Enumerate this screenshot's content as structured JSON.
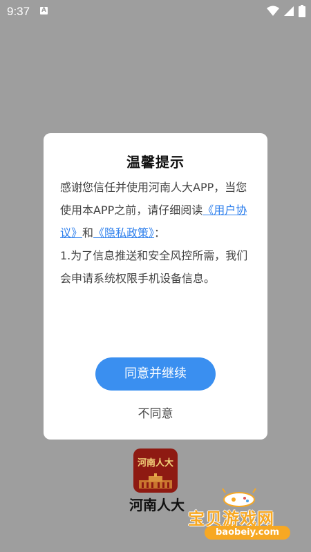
{
  "status_bar": {
    "time": "9:37",
    "notification_icon": "a-icon",
    "icons": [
      "wifi-icon",
      "signal-icon",
      "battery-icon"
    ]
  },
  "dialog": {
    "title": "温馨提示",
    "intro_text": "感谢您信任并使用河南人大APP，当您使用本APP之前，请仔细阅读",
    "user_agreement_link": "《用户协议》",
    "and_text": "和",
    "privacy_policy_link": "《隐私政策》",
    "colon": "：",
    "item_1": "1.为了信息推送和安全风控所需，我们会申请系统权限手机设备信息。",
    "agree_button": "同意并继续",
    "disagree_button": "不同意"
  },
  "app": {
    "logo_text": "河南人大",
    "name": "河南人大"
  },
  "watermark": {
    "title": "宝贝游戏网",
    "url": "baobeiy.com"
  },
  "colors": {
    "overlay": "#9e9e9e",
    "accent": "#3a8ff0",
    "link": "#2f80ed",
    "logo_bg": "#8e1a12",
    "watermark": "#f7a823"
  }
}
